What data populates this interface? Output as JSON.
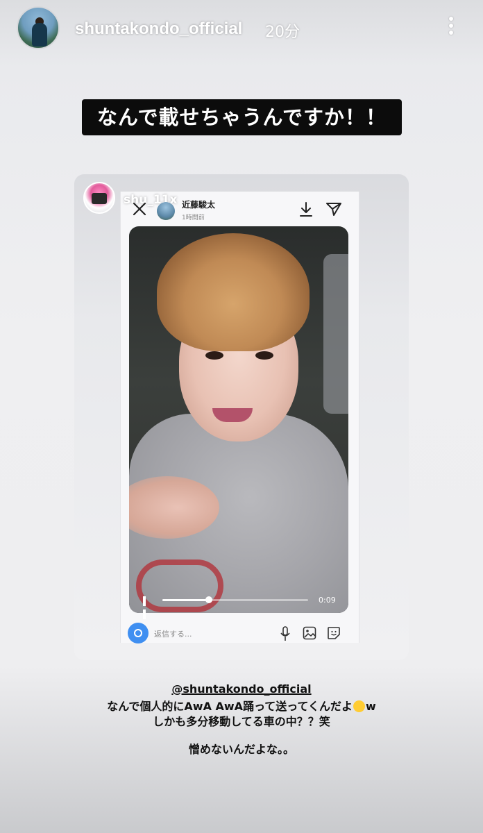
{
  "header": {
    "username": "shuntakondo_official",
    "time_ago": "20分"
  },
  "headline": "なんで載せちゃうんですか！！",
  "repost": {
    "username": "shu_11x",
    "inner": {
      "name": "近藤駿太",
      "time": "1時間前",
      "video": {
        "time": "0:09",
        "progress": 0.32
      },
      "reply_placeholder": "返信する..."
    }
  },
  "caption": {
    "mention": "@shuntakondo_official",
    "line1_before_emoji": "なんで個人的にAwA AwA踊って送ってくんだよ",
    "line1_after_emoji": "w",
    "line2": "しかも多分移動してる車の中？？笑",
    "line3": "憎めないんだよな。。"
  },
  "icons": [
    "more-icon",
    "close-icon",
    "download-icon",
    "send-icon",
    "pause-icon",
    "camera-icon",
    "mic-icon",
    "gallery-icon",
    "sticker-icon",
    "laughing-emoji-icon"
  ]
}
